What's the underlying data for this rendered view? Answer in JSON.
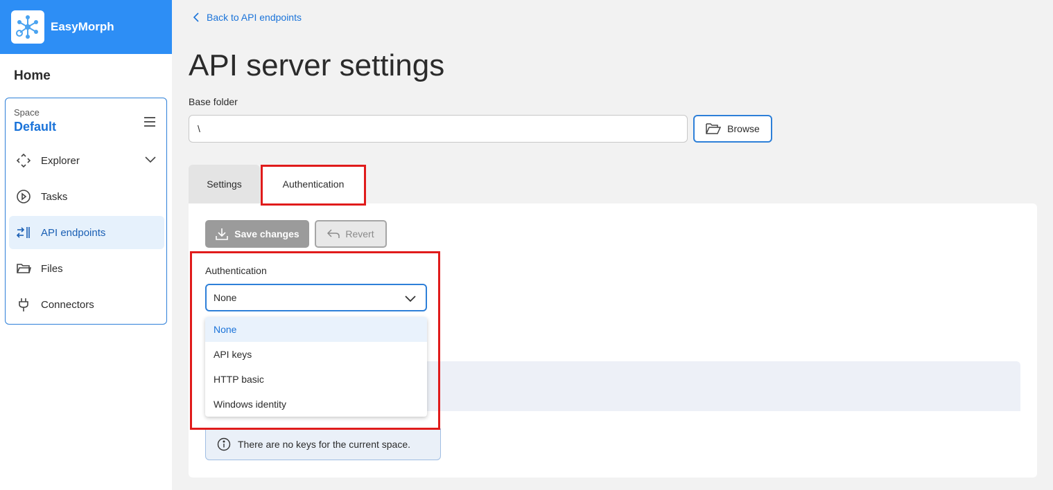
{
  "brand": {
    "name": "EasyMorph",
    "logo_icon": "easymorph-logo-icon",
    "color": "#2d8ef5"
  },
  "sidebar": {
    "home_label": "Home",
    "space": {
      "label": "Space",
      "name": "Default"
    },
    "items": [
      {
        "label": "Explorer",
        "icon": "explorer-icon"
      },
      {
        "label": "Tasks",
        "icon": "play-circle-icon"
      },
      {
        "label": "API endpoints",
        "icon": "api-arrows-icon",
        "active": true
      },
      {
        "label": "Files",
        "icon": "folder-icon"
      },
      {
        "label": "Connectors",
        "icon": "plug-icon"
      }
    ]
  },
  "header": {
    "back_link": "Back to API endpoints",
    "title": "API server settings"
  },
  "base_folder": {
    "label": "Base folder",
    "value": "\\",
    "browse_label": "Browse"
  },
  "tabs": [
    {
      "label": "Settings"
    },
    {
      "label": "Authentication",
      "active": true
    }
  ],
  "toolbar": {
    "save_label": "Save changes",
    "revert_label": "Revert"
  },
  "authentication": {
    "label": "Authentication",
    "selected": "None",
    "options": [
      "None",
      "API keys",
      "HTTP basic",
      "Windows identity"
    ]
  },
  "info": {
    "message": "There are no keys for the current space."
  },
  "colors": {
    "accent": "#2d7fd8",
    "highlight": "#e01b1b"
  }
}
